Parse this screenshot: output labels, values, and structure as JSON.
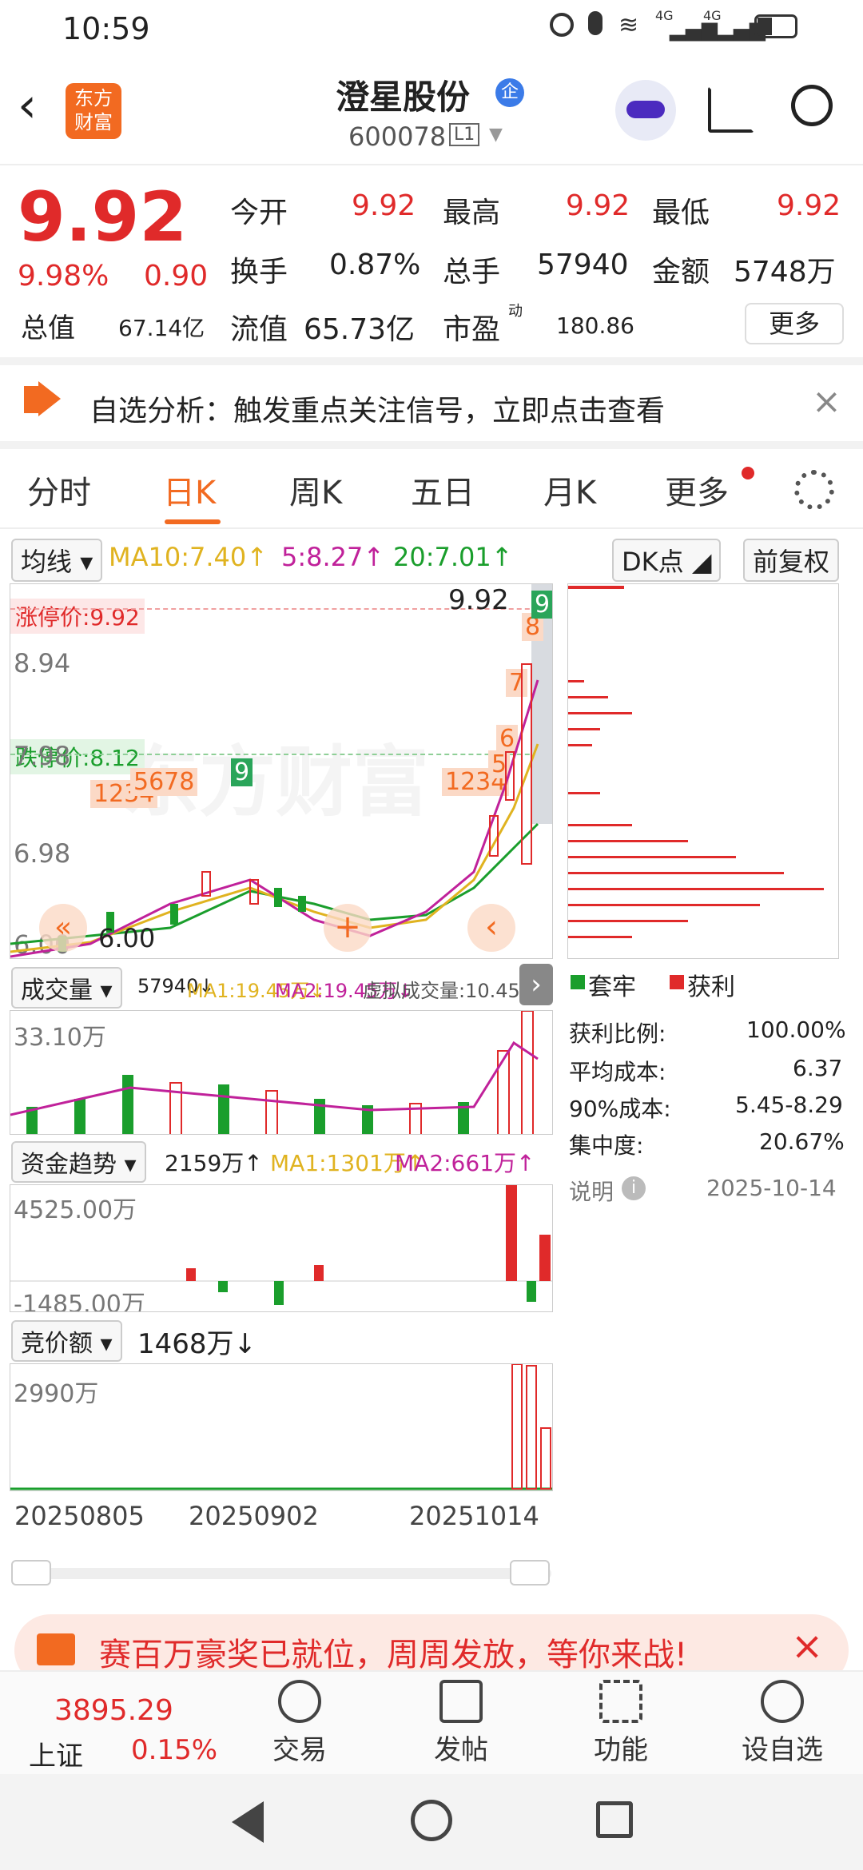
{
  "status": {
    "time": "10:59",
    "net1": "4G",
    "net2": "4G"
  },
  "header": {
    "logo_line1": "东方",
    "logo_line2": "财富",
    "title": "澄星股份",
    "badge": "企",
    "code": "600078",
    "level": "L1"
  },
  "quote": {
    "price": "9.92",
    "pct": "9.98%",
    "chg": "0.90",
    "open_label": "今开",
    "open": "9.92",
    "high_label": "最高",
    "high": "9.92",
    "low_label": "最低",
    "low": "9.92",
    "turnover_label": "换手",
    "turnover": "0.87%",
    "vol_label": "总手",
    "vol": "57940",
    "amount_label": "金额",
    "amount": "5748万",
    "mcap_label": "总值",
    "mcap": "67.14亿",
    "float_label": "流值",
    "float": "65.73亿",
    "pe_label": "市盈",
    "pe_sup": "动",
    "pe": "180.86",
    "more": "更多"
  },
  "alert": {
    "text": "自选分析：触发重点关注信号，立即点击查看"
  },
  "tabs": [
    "分时",
    "日K",
    "周K",
    "五日",
    "月K",
    "更多"
  ],
  "chart": {
    "ma_selector": "均线",
    "ma10": "MA10:7.40↑",
    "ma5": "5:8.27↑",
    "ma20": "20:7.01↑",
    "dk": "DK点",
    "adjust": "前复权",
    "limit_up": "涨停价:9.92",
    "limit_down": "跌停价:8.12",
    "price_top": "9.92",
    "y_894": "8.94",
    "y_798": "7.98",
    "y_698": "6.98",
    "y_600": "6.00",
    "low_marker": "6.00",
    "seq_a": "1234",
    "seq_b": "5678",
    "seq_c": "9",
    "seq_d": "1234",
    "seq_5": "5",
    "seq_6": "6",
    "seq_7": "7",
    "seq_8": "8",
    "seq_9": "9",
    "watermark": "东方财富",
    "vol_selector": "成交量",
    "vol_val": "57940↓",
    "vol_ma1": "MA1:19.45万↓",
    "vol_ma2": "MA2:19.45万↓",
    "vol_virtual": "虚拟成交量:10.45万",
    "vol_y": "33.10万",
    "fund_selector": "资金趋势",
    "fund_val": "2159万↑",
    "fund_ma1": "MA1:1301万↑",
    "fund_ma2": "MA2:661万↑",
    "fund_y1": "4525.00万",
    "fund_y2": "-1485.00万",
    "bid_selector": "竞价额",
    "bid_val": "1468万↓",
    "bid_y": "2990万",
    "dates": [
      "20250805",
      "20250902",
      "20251014"
    ]
  },
  "chip": {
    "legend_trap": "套牢",
    "legend_profit": "获利",
    "profit_ratio_label": "获利比例:",
    "profit_ratio": "100.00%",
    "avg_cost_label": "平均成本:",
    "avg_cost": "6.37",
    "cost90_label": "90%成本:",
    "cost90": "5.45-8.29",
    "conc_label": "集中度:",
    "conc": "20.67%",
    "note_label": "说明",
    "date": "2025-10-14"
  },
  "banner": {
    "text": "赛百万豪奖已就位，周周发放，等你来战!",
    "prefix": "赛"
  },
  "bottom": {
    "index_value": "3895.29",
    "index_name": "上证",
    "index_pct": "0.15%",
    "trade": "交易",
    "post": "发帖",
    "func": "功能",
    "fav": "设自选"
  },
  "colors": {
    "up": "#e02a2a",
    "down": "#1a9e2c",
    "accent": "#f26a21",
    "ma5": "#c0219a",
    "ma10": "#e0b320",
    "ma20": "#1a9e2c"
  }
}
